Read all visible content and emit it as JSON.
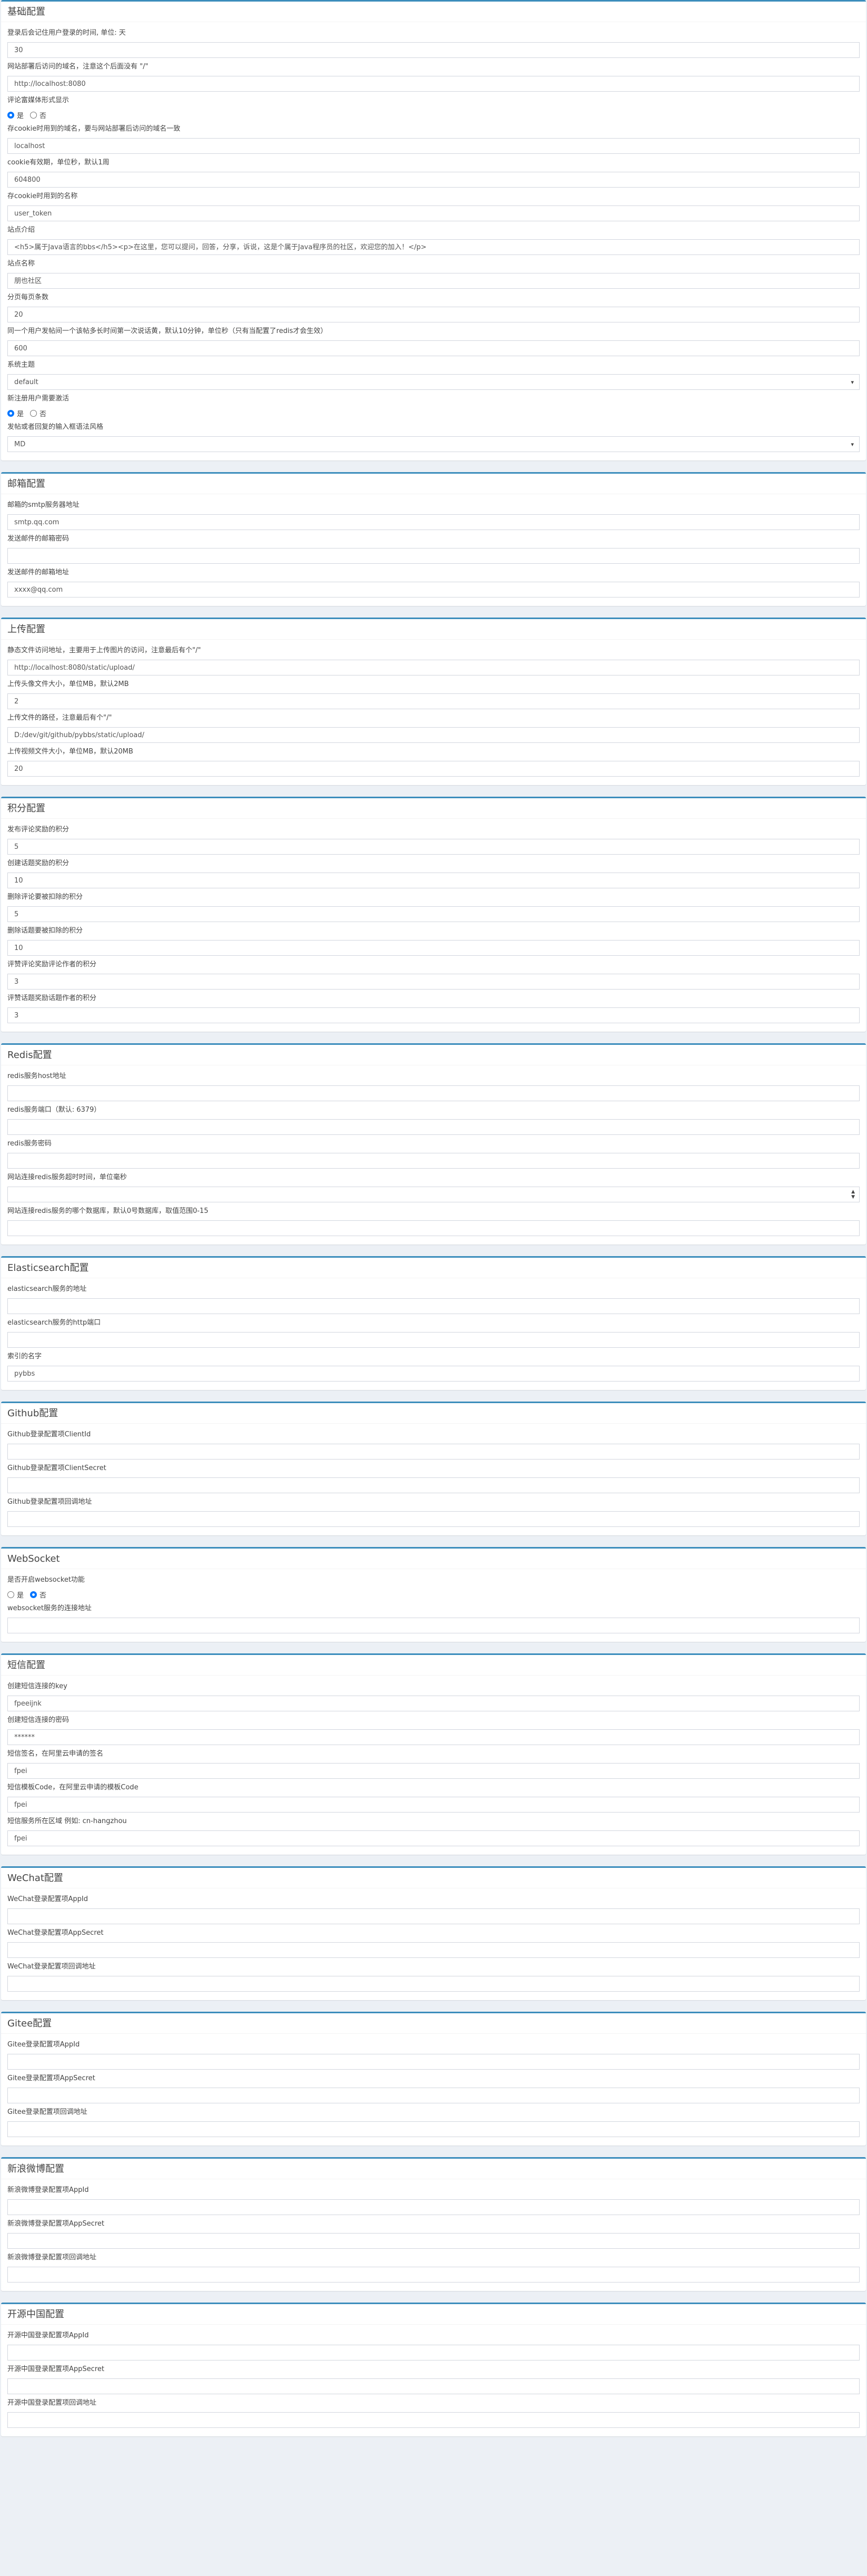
{
  "sections": {
    "basic": {
      "title": "基础配置",
      "f1_label": "登录后会记住用户登录的时间, 单位: 天",
      "f1_value": "30",
      "f2_label": "网站部署后访问的域名，注意这个后面没有 \"/\"",
      "f2_value": "http://localhost:8080",
      "f3_label": "评论富媒体形式显示",
      "yes": "是",
      "no": "否",
      "f4_label": "存cookie时用到的域名，要与网站部署后访问的域名一致",
      "f4_value": "localhost",
      "f5_label": "cookie有效期，单位秒，默认1周",
      "f5_value": "604800",
      "f6_label": "存cookie时用到的名称",
      "f6_value": "user_token",
      "f7_label": "站点介绍",
      "f7_value": "<h5>属于Java语言的bbs</h5><p>在这里，您可以提问，回答，分享，诉说，这是个属于Java程序员的社区，欢迎您的加入！</p>",
      "f8_label": "站点名称",
      "f8_value": "朋也社区",
      "f9_label": "分页每页条数",
      "f9_value": "20",
      "f10_label": "同一个用户发帖间一个该帖多长时间第一次说话黄，默认10分钟，单位秒（只有当配置了redis才会生效）",
      "f10_value": "600",
      "f11_label": "系统主题",
      "f11_value": "default",
      "f12_label": "新注册用户需要激活",
      "f13_label": "发帖或者回复的输入框语法风格",
      "f13_value": "MD"
    },
    "email": {
      "title": "邮箱配置",
      "f1_label": "邮箱的smtp服务器地址",
      "f1_value": "smtp.qq.com",
      "f2_label": "发送邮件的邮箱密码",
      "f2_value": "",
      "f3_label": "发送邮件的邮箱地址",
      "f3_value": "xxxx@qq.com"
    },
    "upload": {
      "title": "上传配置",
      "f1_label": "静态文件访问地址，主要用于上传图片的访问，注意最后有个\"/\"",
      "f1_value": "http://localhost:8080/static/upload/",
      "f2_label": "上传头像文件大小，单位MB，默认2MB",
      "f2_value": "2",
      "f3_label": "上传文件的路径，注意最后有个\"/\"",
      "f3_value": "D:/dev/git/github/pybbs/static/upload/",
      "f4_label": "上传视频文件大小，单位MB，默认20MB",
      "f4_value": "20"
    },
    "score": {
      "title": "积分配置",
      "f1_label": "发布评论奖励的积分",
      "f1_value": "5",
      "f2_label": "创建话题奖励的积分",
      "f2_value": "10",
      "f3_label": "删除评论要被扣除的积分",
      "f3_value": "5",
      "f4_label": "删除话题要被扣除的积分",
      "f4_value": "10",
      "f5_label": "评赞评论奖励评论作者的积分",
      "f5_value": "3",
      "f6_label": "评赞话题奖励话题作者的积分",
      "f6_value": "3"
    },
    "redis": {
      "title": "Redis配置",
      "f1_label": "redis服务host地址",
      "f1_value": "",
      "f2_label": "redis服务端口（默认: 6379）",
      "f2_value": "",
      "f3_label": "redis服务密码",
      "f3_value": "",
      "f4_label": "网站连接redis服务超时时间，单位毫秒",
      "f4_value": "",
      "f5_label": "网站连接redis服务的哪个数据库，默认0号数据库，取值范围0-15",
      "f5_value": ""
    },
    "es": {
      "title": "Elasticsearch配置",
      "f1_label": "elasticsearch服务的地址",
      "f1_value": "",
      "f2_label": "elasticsearch服务的http端口",
      "f2_value": "",
      "f3_label": "索引的名字",
      "f3_value": "pybbs"
    },
    "github": {
      "title": "Github配置",
      "f1_label": "Github登录配置项ClientId",
      "f1_value": "",
      "f2_label": "Github登录配置项ClientSecret",
      "f2_value": "",
      "f3_label": "Github登录配置项回调地址",
      "f3_value": ""
    },
    "websocket": {
      "title": "WebSocket",
      "f1_label": "是否开启websocket功能",
      "f2_label": "websocket服务的连接地址",
      "f2_value": ""
    },
    "sms": {
      "title": "短信配置",
      "f1_label": "创建短信连接的key",
      "f1_value": "fpeeijnk",
      "f2_label": "创建短信连接的密码",
      "f2_value": "******",
      "f3_label": "短信签名，在阿里云申请的签名",
      "f3_value": "fpei",
      "f4_label": "短信模板Code，在阿里云申请的模板Code",
      "f4_value": "fpei",
      "f5_label": "短信服务所在区域 例如: cn-hangzhou",
      "f5_value": "fpei"
    },
    "wechat": {
      "title": "WeChat配置",
      "f1_label": "WeChat登录配置项AppId",
      "f1_value": "",
      "f2_label": "WeChat登录配置项AppSecret",
      "f2_value": "",
      "f3_label": "WeChat登录配置项回调地址",
      "f3_value": ""
    },
    "gitee": {
      "title": "Gitee配置",
      "f1_label": "Gitee登录配置项AppId",
      "f1_value": "",
      "f2_label": "Gitee登录配置项AppSecret",
      "f2_value": "",
      "f3_label": "Gitee登录配置项回调地址",
      "f3_value": ""
    },
    "weibo": {
      "title": "新浪微博配置",
      "f1_label": "新浪微博登录配置项AppId",
      "f1_value": "",
      "f2_label": "新浪微博登录配置项AppSecret",
      "f2_value": "",
      "f3_label": "新浪微博登录配置项回调地址",
      "f3_value": ""
    },
    "oschina": {
      "title": "开源中国配置",
      "f1_label": "开源中国登录配置项AppId",
      "f1_value": "",
      "f2_label": "开源中国登录配置项AppSecret",
      "f2_value": "",
      "f3_label": "开源中国登录配置项回调地址",
      "f3_value": ""
    }
  },
  "icons": {
    "select": "chevron-down-icon",
    "spinner": "spinner-arrows-icon"
  },
  "colors": {
    "accent": "#3c8dbc",
    "background": "#ecf0f5",
    "radio_checked": "#0075ff"
  }
}
